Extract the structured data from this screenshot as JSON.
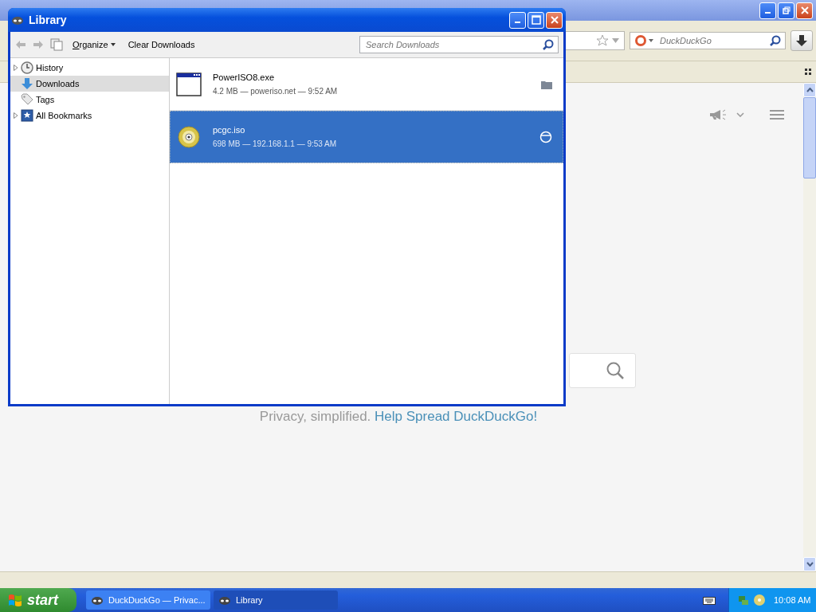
{
  "browser": {
    "search_placeholder": "DuckDuckGo",
    "tagline": "Privacy, simplified.",
    "link": "Help Spread DuckDuckGo!"
  },
  "library": {
    "title": "Library",
    "organize": "Organize",
    "clear": "Clear Downloads",
    "search_placeholder": "Search Downloads",
    "sidebar": [
      {
        "label": "History",
        "kind": "history",
        "expandable": true,
        "selected": false
      },
      {
        "label": "Downloads",
        "kind": "downloads",
        "expandable": false,
        "selected": true
      },
      {
        "label": "Tags",
        "kind": "tags",
        "expandable": false,
        "selected": false
      },
      {
        "label": "All Bookmarks",
        "kind": "bookmarks",
        "expandable": true,
        "selected": false
      }
    ],
    "downloads": [
      {
        "name": "PowerISO8.exe",
        "details": "4.2 MB — poweriso.net — 9:52 AM",
        "kind": "exe",
        "selected": false
      },
      {
        "name": "pcgc.iso",
        "details": "698 MB — 192.168.1.1 — 9:53 AM",
        "kind": "iso",
        "selected": true
      }
    ]
  },
  "taskbar": {
    "start": "start",
    "tasks": [
      {
        "label": "DuckDuckGo — Privac...",
        "selected": false
      },
      {
        "label": "Library",
        "selected": true
      }
    ],
    "clock": "10:08 AM"
  }
}
